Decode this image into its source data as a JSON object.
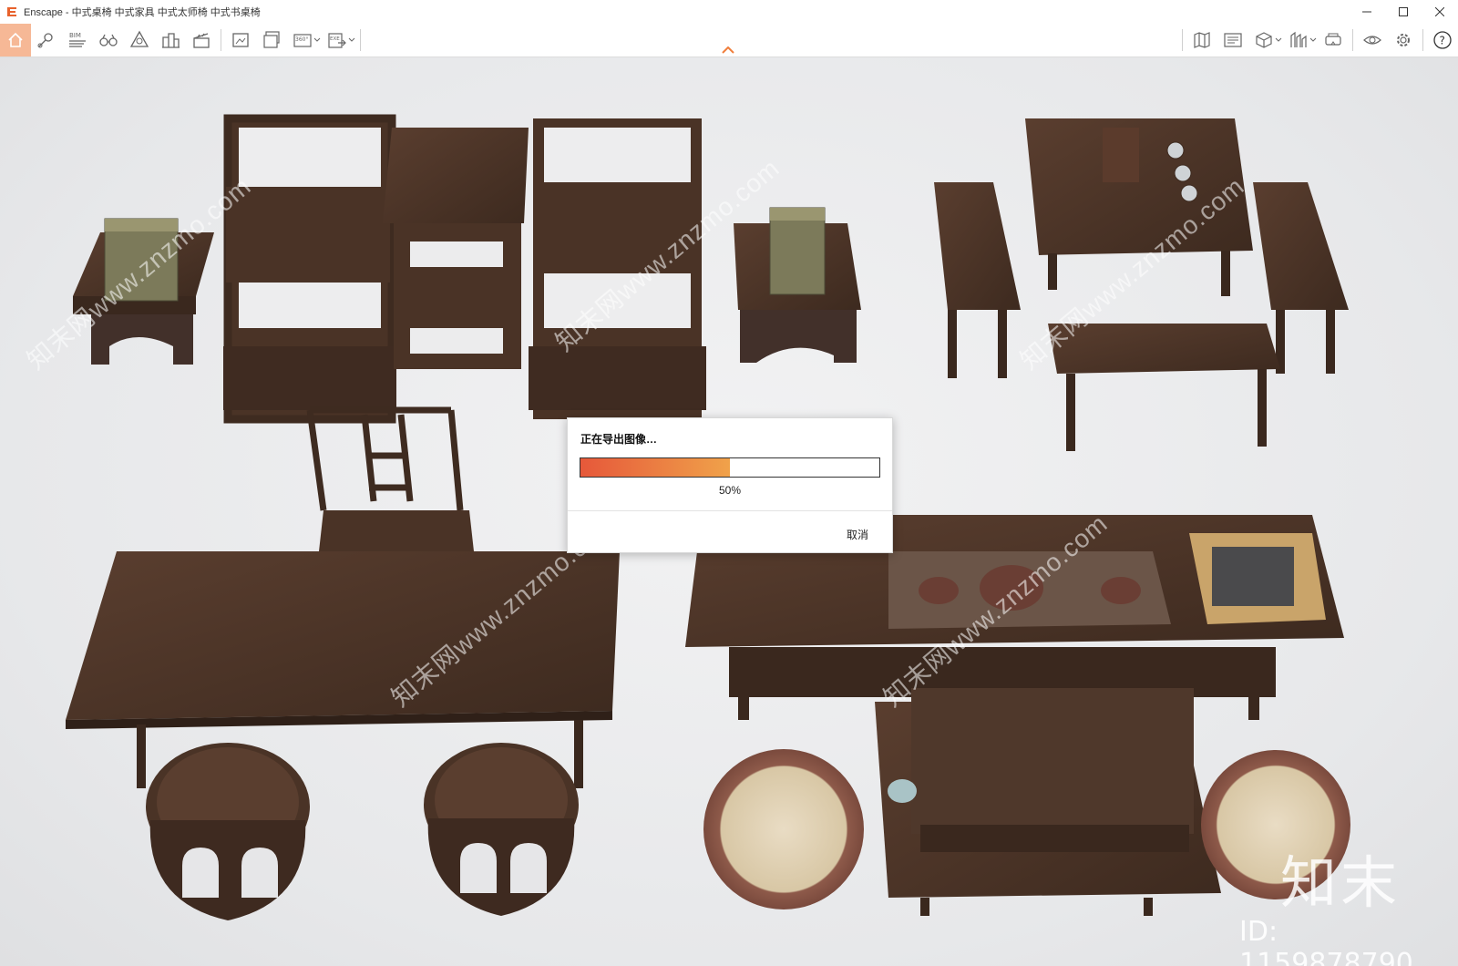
{
  "window": {
    "app_name": "Enscape",
    "title": "Enscape - 中式桌椅 中式家具 中式太师椅 中式书桌椅"
  },
  "toolbar": {
    "left_icons": [
      "home-icon",
      "location-pin-icon",
      "bim-icon",
      "binoculars-icon",
      "perspective-icon",
      "buildings-icon",
      "clapboard-icon",
      "screenshot-icon",
      "batch-render-icon",
      "panorama-360-icon",
      "export-exe-icon"
    ],
    "right_icons": [
      "map-icon",
      "views-icon",
      "cube-icon",
      "asset-library-icon",
      "vr-headset-icon",
      "visual-settings-icon",
      "gear-icon",
      "help-icon"
    ],
    "bim_label": "BIM",
    "pano_label": "360°",
    "exe_label": "EXE",
    "help_label": "?"
  },
  "dialog": {
    "title": "正在导出图像…",
    "progress": 0.5,
    "percent_text": "50%",
    "cancel_label": "取消"
  },
  "watermark": {
    "text": "知末网www.znzmo.com",
    "brand": "知末",
    "id_text": "ID: 1159878790"
  },
  "colors": {
    "accent": "#f07e3c",
    "progress_start": "#e6583a",
    "progress_end": "#f0a24a",
    "wood": "#4a3326"
  }
}
